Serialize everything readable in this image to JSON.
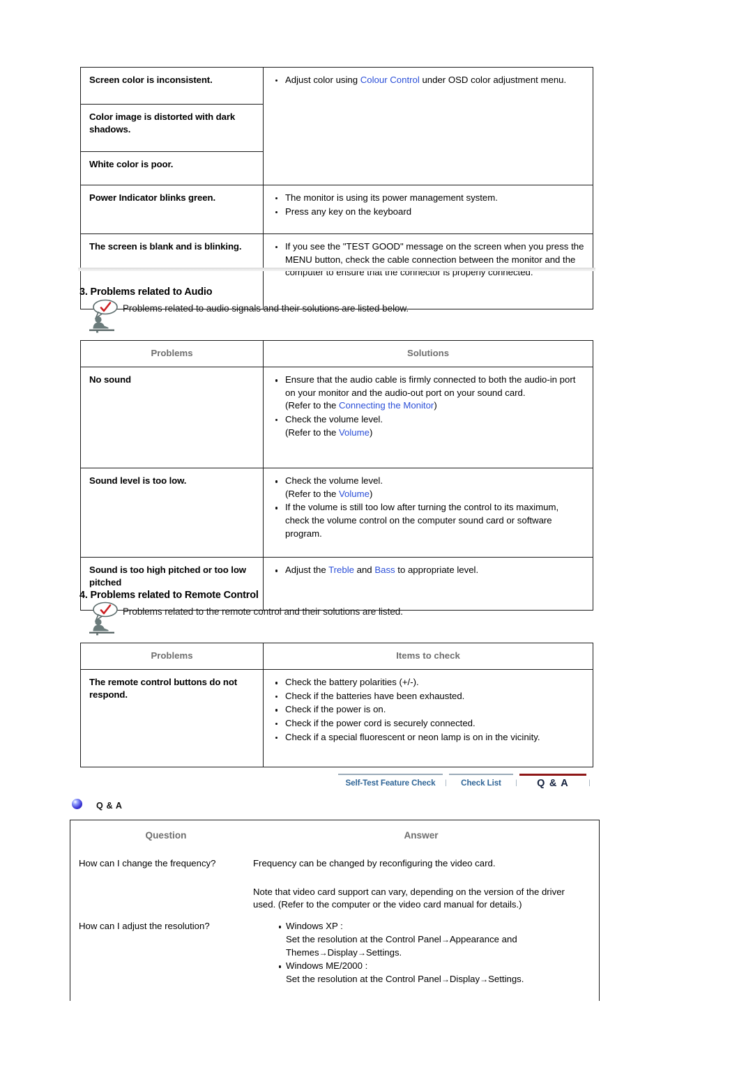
{
  "display_table": {
    "rows": [
      {
        "problem": "Screen color is inconsistent.",
        "solutions": []
      },
      {
        "problem": "Color image is distorted with dark shadows.",
        "solutions": []
      },
      {
        "problem": "White color is poor.",
        "solutions": []
      },
      {
        "problem": "Power Indicator blinks green.",
        "solutions": [
          "The monitor is using its power management system.",
          "Press any key on the keyboard"
        ]
      },
      {
        "problem": "The screen is blank and is blinking.",
        "solutions": [
          "If you see the \"TEST GOOD\" message on the screen when you press the MENU button, check the cable connection between the monitor and the computer to ensure that the connector is properly connected."
        ]
      }
    ],
    "merged_solution": {
      "pre": "Adjust color using ",
      "link": "Colour Control",
      "post": " under OSD color adjustment menu."
    }
  },
  "audio_section": {
    "heading": "3. Problems related to Audio",
    "note": "Problems related to audio signals and their solutions are listed below.",
    "icon": "person-check-note-icon",
    "columns": [
      "Problems",
      "Solutions"
    ],
    "rows": [
      {
        "problem": "No sound",
        "items": [
          {
            "text": "Ensure that the audio cable is firmly connected to both the audio-in port on your monitor and the audio-out port on your sound card.",
            "refer_pre": "(Refer to the ",
            "refer_link": "Connecting the Monitor",
            "refer_post": ")"
          },
          {
            "text": "Check the volume level.",
            "refer_pre": "(Refer to the ",
            "refer_link": "Volume",
            "refer_post": ")"
          }
        ]
      },
      {
        "problem": "Sound level is too low.",
        "items": [
          {
            "text": "Check the volume level.",
            "refer_pre": "(Refer to the ",
            "refer_link": "Volume",
            "refer_post": ")"
          },
          {
            "text": "If the volume is still too low after turning the control to its maximum, check the volume control on the computer sound card or software program.",
            "refer_pre": "",
            "refer_link": "",
            "refer_post": ""
          }
        ]
      },
      {
        "problem": "Sound is too high pitched or too low pitched",
        "items": [
          {
            "text_pre": "Adjust the ",
            "link1": "Treble",
            "text_mid": " and ",
            "link2": "Bass",
            "text_post": " to appropriate level."
          }
        ]
      }
    ]
  },
  "remote_section": {
    "heading": "4. Problems related to Remote Control",
    "note": "Problems related to the remote control and their solutions are listed.",
    "icon": "person-check-note-icon",
    "columns": [
      "Problems",
      "Items to check"
    ],
    "row": {
      "problem": "The remote control buttons do not respond.",
      "items": [
        "Check the battery polarities (+/-).",
        "Check if the batteries have been exhausted.",
        "Check if the power is on.",
        "Check if the power cord is securely connected.",
        "Check if a special fluorescent or neon lamp is on in the vicinity."
      ]
    }
  },
  "tabs": {
    "items": [
      {
        "label": "Self-Test Feature Check",
        "active": false
      },
      {
        "label": "Check List",
        "active": false
      },
      {
        "label": "Q & A",
        "active": true
      }
    ],
    "separator": "|",
    "inactive_color": "#2e6496",
    "active_color": "#14213d",
    "active_rule_color": "#8e1616",
    "inactive_rule_color": "#9aaab8"
  },
  "qa_section": {
    "bullet_icon": "blue-orb-bullet-icon",
    "label": "Q & A",
    "columns": [
      "Question",
      "Answer"
    ],
    "rows": [
      {
        "question": "How can I change the frequency?",
        "answer_lines": [
          "Frequency can be changed by reconfiguring the video card.",
          "Note that video card support can vary, depending on the version of the driver used. (Refer to the computer or the video card manual for details.)"
        ]
      },
      {
        "question": "How can I adjust the resolution?",
        "bullets": [
          {
            "title": "Windows XP :",
            "detail_a": "Set the resolution at the Control Panel",
            "detail_b": "Appearance and Themes",
            "detail_c": "Display",
            "detail_d": "Settings."
          },
          {
            "title": "Windows ME/2000 :",
            "detail_a": "Set the resolution at the Control Panel",
            "detail_b": "Display",
            "detail_c": "Settings.",
            "detail_d": ""
          }
        ]
      }
    ]
  }
}
